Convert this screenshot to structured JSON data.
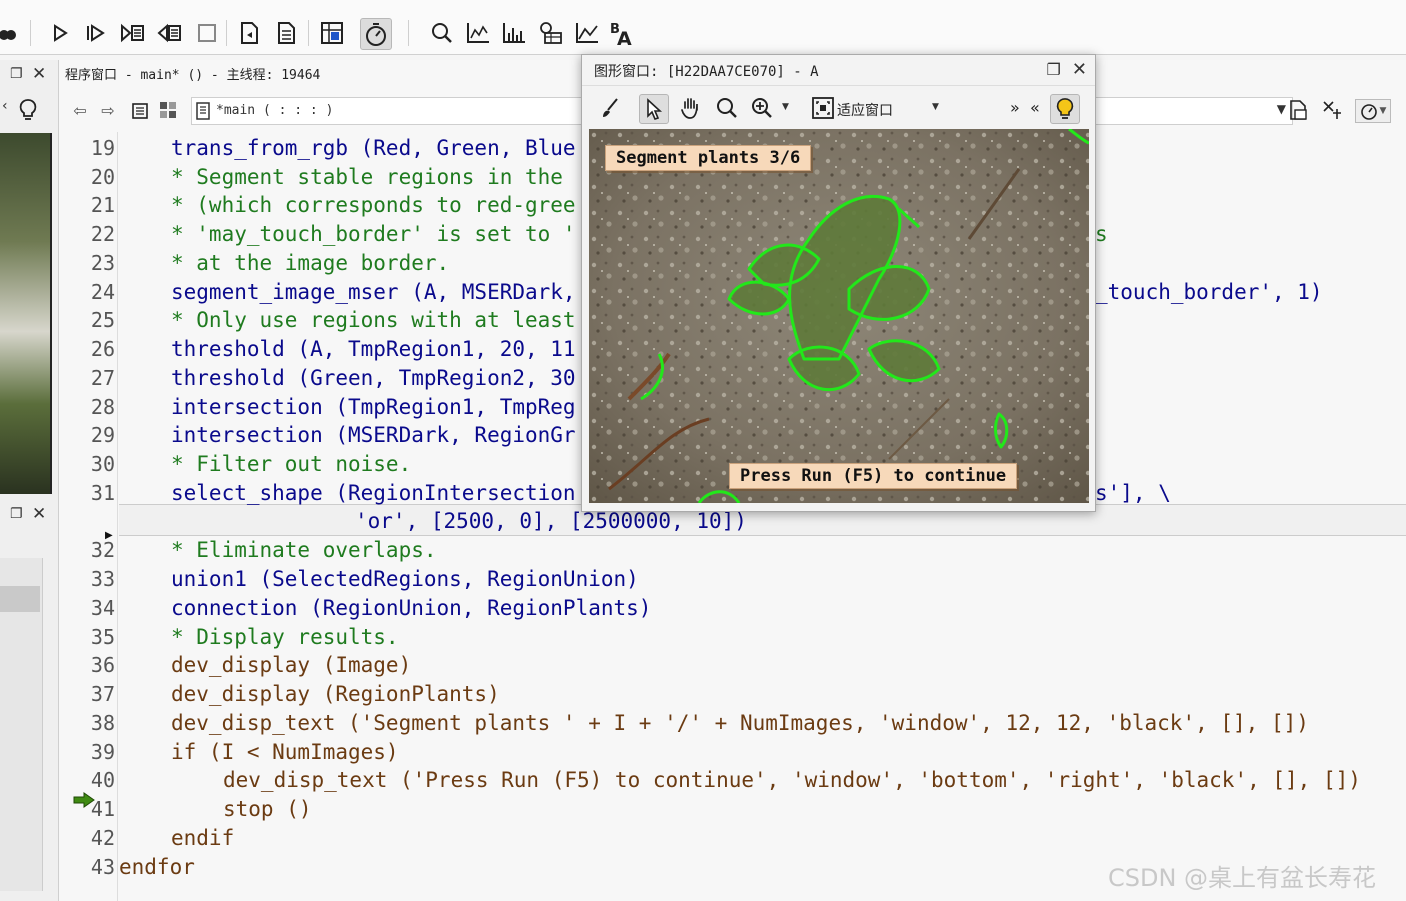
{
  "program_window": {
    "title": "程序窗口 - main* () - 主线程: 19464",
    "procedure_value": "*main ( : : : )"
  },
  "editor": {
    "lines": [
      {
        "n": "19",
        "text": "trans_from_rgb (Red, Green, Blue"
      },
      {
        "n": "20",
        "text": "* Segment stable regions in the"
      },
      {
        "n": "21",
        "text": "* (which corresponds to red-gree"
      },
      {
        "n": "22",
        "text": "* 'may_touch_border' is set to '",
        "tail": "s"
      },
      {
        "n": "23",
        "text": "* at the image border."
      },
      {
        "n": "24",
        "text": "segment_image_mser (A, MSERDark,",
        "tail": "_touch_border', 1)"
      },
      {
        "n": "25",
        "text": "* Only use regions with at least"
      },
      {
        "n": "26",
        "text": "threshold (A, TmpRegion1, 20, 11"
      },
      {
        "n": "27",
        "text": "threshold (Green, TmpRegion2, 30"
      },
      {
        "n": "28",
        "text": "intersection (TmpRegion1, TmpReg"
      },
      {
        "n": "29",
        "text": "intersection (MSERDark, RegionGr"
      },
      {
        "n": "30",
        "text": "* Filter out noise."
      },
      {
        "n": "31",
        "text": "select_shape (RegionIntersection",
        "tail": "s'], \\",
        "cont": "'or', [2500, 0], [2500000, 10])"
      },
      {
        "n": "32",
        "text": "* Eliminate overlaps."
      },
      {
        "n": "33",
        "text": "union1 (SelectedRegions, RegionUnion)"
      },
      {
        "n": "34",
        "text": "connection (RegionUnion, RegionPlants)"
      },
      {
        "n": "35",
        "text": "* Display results."
      },
      {
        "n": "36",
        "text": "dev_display (Image)"
      },
      {
        "n": "37",
        "text": "dev_display (RegionPlants)"
      },
      {
        "n": "38",
        "text": "dev_disp_text ('Segment plants ' + I + '/' + NumImages, 'window', 12, 12, 'black', [], [])"
      },
      {
        "n": "39",
        "text": "if (I < NumImages)"
      },
      {
        "n": "40",
        "text": "dev_disp_text ('Press Run (F5) to continue', 'window', 'bottom', 'right', 'black', [], [])"
      },
      {
        "n": "41",
        "text": "stop ()"
      },
      {
        "n": "42",
        "text": "endif"
      },
      {
        "n": "43",
        "text": "endfor"
      }
    ]
  },
  "graphics_window": {
    "title": "图形窗口: [H22DAA7CE070] - A",
    "fit_label": "适应窗口",
    "overlay_top": "Segment plants 3/6",
    "overlay_bottom": "Press Run (F5) to continue"
  },
  "watermark": "CSDN @桌上有盆长寿花",
  "colors": {
    "region_outline": "#22e81a",
    "text_box_bg": "#f7d9ba",
    "code_blue": "#0a0a8c",
    "comment_green": "#1f7b1f"
  }
}
